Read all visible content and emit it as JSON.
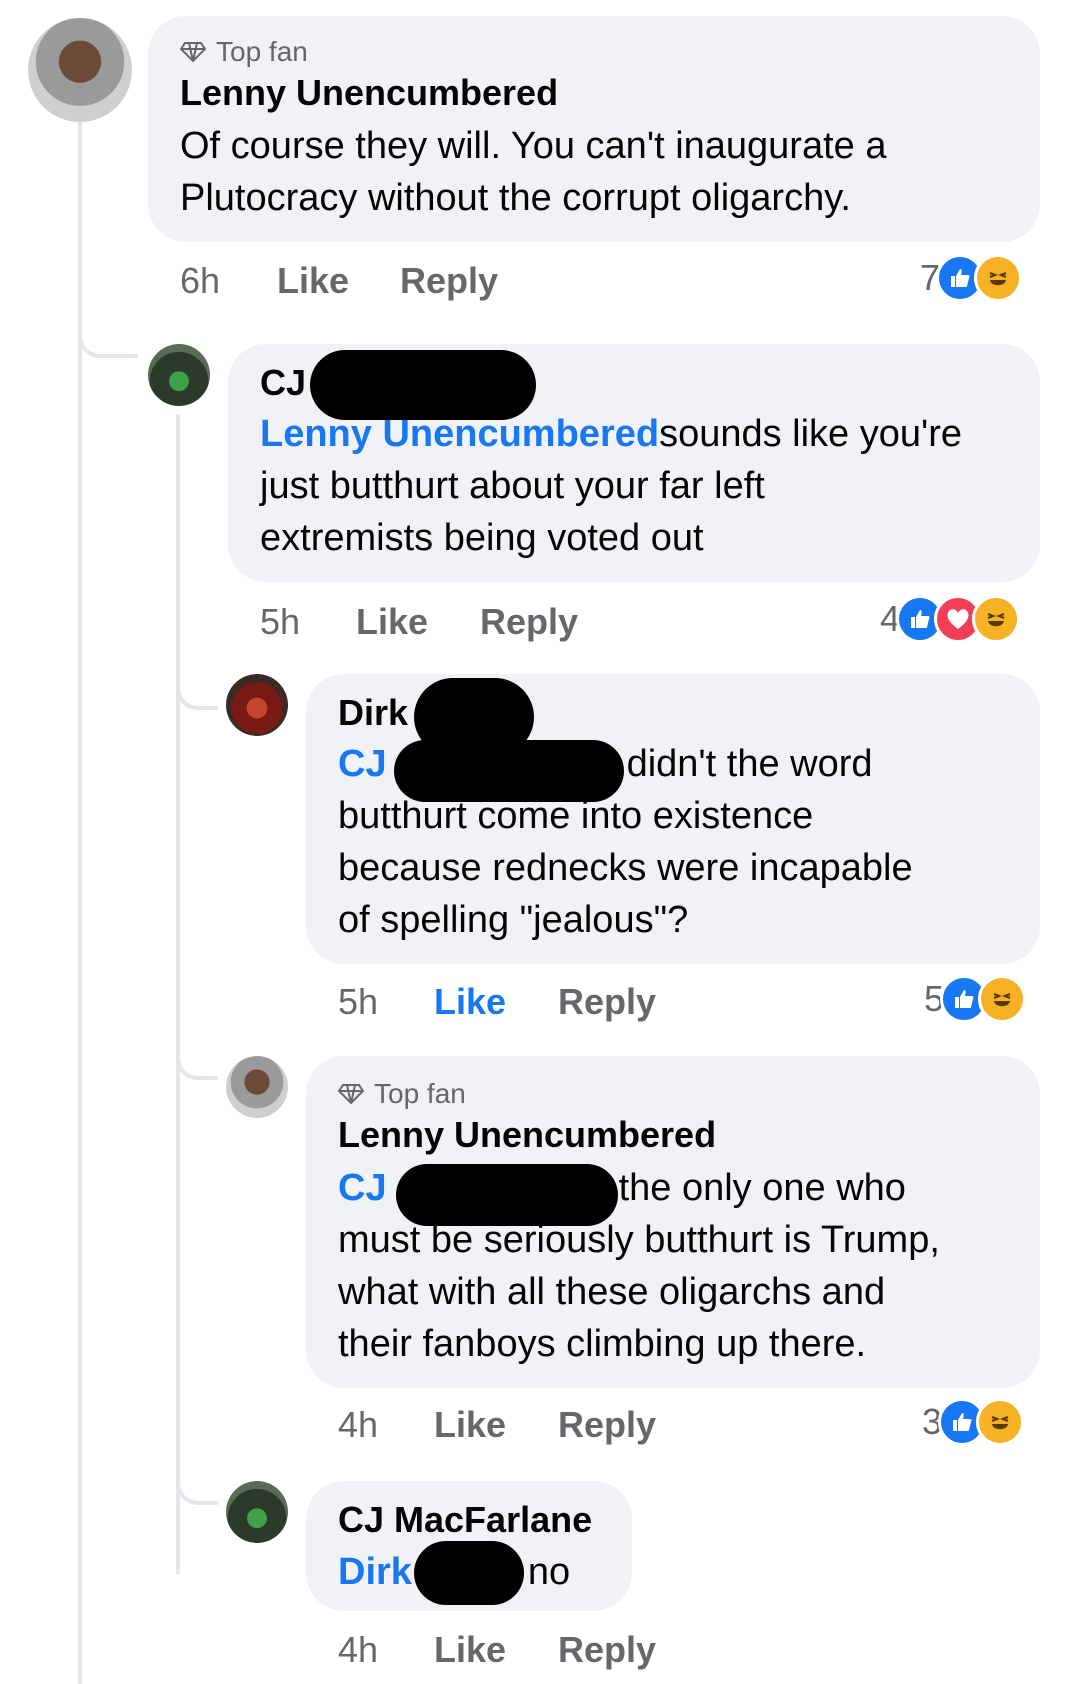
{
  "comments": [
    {
      "badge": "Top fan",
      "author": "Lenny Unencumbered",
      "lines": [
        "Of course they will. You can't inaugurate a",
        "Plutocracy without the corrupt oligarchy."
      ],
      "time": "6h",
      "like": "Like",
      "reply": "Reply",
      "reaction_count": "7",
      "reactions": [
        "like-icon",
        "haha-icon"
      ]
    },
    {
      "author": "CJ",
      "mention": "Lenny Unencumbered",
      "lines": [
        "sounds like you're",
        "just butthurt about your far left",
        "extremists being voted out"
      ],
      "time": "5h",
      "like": "Like",
      "reply": "Reply",
      "reaction_count": "4",
      "reactions": [
        "like-icon",
        "love-icon",
        "haha-icon"
      ]
    },
    {
      "author": "Dirk",
      "mention": "CJ",
      "lines": [
        "didn't the word",
        "butthurt come into existence",
        "because rednecks were incapable",
        "of spelling \"jealous\"?"
      ],
      "time": "5h",
      "like": "Like",
      "reply": "Reply",
      "like_active": true,
      "reaction_count": "5",
      "reactions": [
        "like-icon",
        "haha-icon"
      ]
    },
    {
      "badge": "Top fan",
      "author": "Lenny Unencumbered",
      "mention": "CJ",
      "lines": [
        "the only one who",
        "must be seriously butthurt is Trump,",
        "what with all these oligarchs and",
        "their fanboys climbing up there."
      ],
      "time": "4h",
      "like": "Like",
      "reply": "Reply",
      "reaction_count": "3",
      "reactions": [
        "like-icon",
        "haha-icon"
      ]
    },
    {
      "author": "CJ MacFarlane",
      "mention": "Dirk",
      "lines": [
        "no"
      ],
      "time": "4h",
      "like": "Like",
      "reply": "Reply"
    }
  ],
  "colors": {
    "link": "#1877f2",
    "bubble": "#f0f2f5",
    "meta": "#65676b",
    "like": "#1877f2",
    "love": "#f33e58",
    "haha": "#f7b125"
  }
}
